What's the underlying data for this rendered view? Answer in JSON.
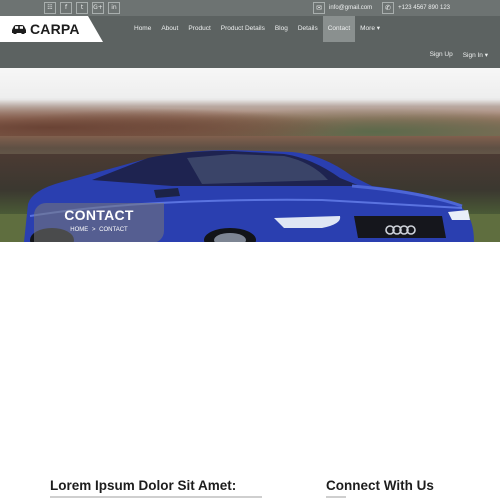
{
  "topbar": {
    "social": [
      {
        "icon": "rss-icon",
        "glyph": "☷"
      },
      {
        "icon": "facebook-icon",
        "glyph": "f"
      },
      {
        "icon": "twitter-icon",
        "glyph": "t"
      },
      {
        "icon": "google-plus-icon",
        "glyph": "G+"
      },
      {
        "icon": "linkedin-icon",
        "glyph": "in"
      }
    ],
    "email": "info@gmail.com",
    "phone": "+123 4567 890 123"
  },
  "nav": {
    "brand": "CARPA",
    "items": [
      {
        "label": "Home"
      },
      {
        "label": "About"
      },
      {
        "label": "Product"
      },
      {
        "label": "Product Details"
      },
      {
        "label": "Blog"
      },
      {
        "label": "Details"
      },
      {
        "label": "Contact"
      },
      {
        "label": "More ▾"
      }
    ],
    "active": "Contact",
    "signup": "Sign Up",
    "signin": "Sign In ▾"
  },
  "hero": {
    "title": "CONTACT",
    "breadcrumb_home": "HOME",
    "breadcrumb_sep": ">",
    "breadcrumb_current": "CONTACT"
  },
  "sections": {
    "left_title": "Lorem Ipsum Dolor Sit Amet:",
    "right_title": "Connect With Us"
  },
  "colors": {
    "topbar": "#6d7372",
    "navbar": "#5c6261",
    "nav_active": "#8a908f",
    "car_blue": "#2a3fb0"
  }
}
